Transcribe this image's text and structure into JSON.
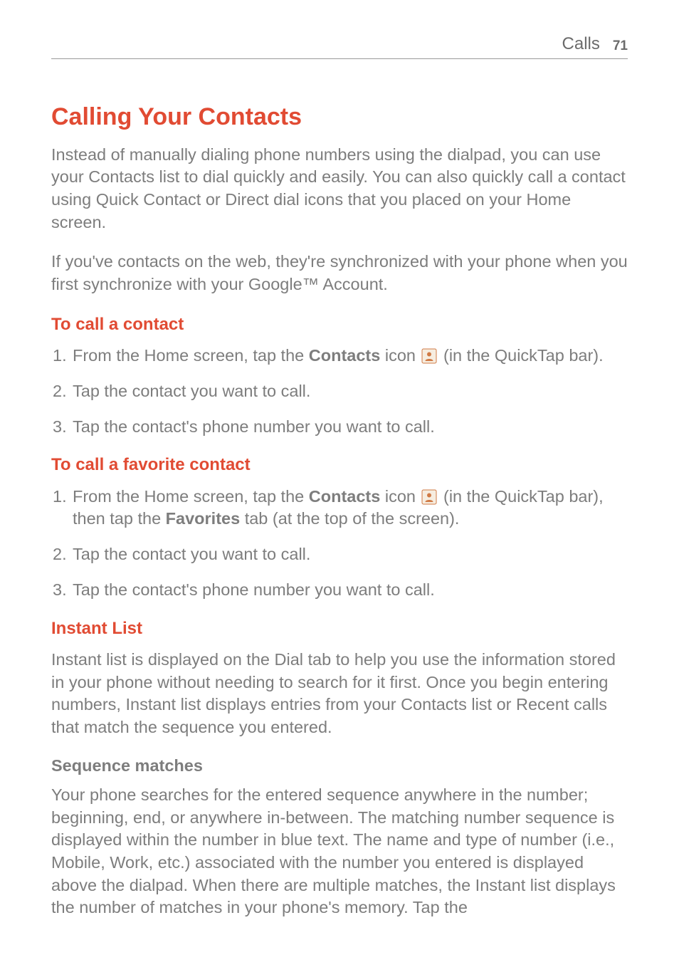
{
  "header": {
    "section": "Calls",
    "page_number": "71"
  },
  "h1": "Calling Your Contacts",
  "intro_p1": "Instead of manually dialing phone numbers using the dialpad, you can use your Contacts list to dial quickly and easily. You can also quickly call a contact using Quick Contact or Direct dial icons that you placed on your Home screen.",
  "intro_p2": "If you've contacts on the web, they're synchronized with your phone when you first synchronize with your Google™ Account.",
  "sub1": {
    "title": "To call a contact",
    "steps": {
      "s1_prefix": "From the Home screen, tap the ",
      "s1_bold": "Contacts",
      "s1_icon_label": " icon ",
      "s1_suffix": " (in the QuickTap bar).",
      "s2": "Tap the contact you want to call.",
      "s3": "Tap the contact's phone number you want to call."
    }
  },
  "sub2": {
    "title": "To call a favorite contact",
    "steps": {
      "s1_prefix": "From the Home screen, tap the ",
      "s1_bold": "Contacts",
      "s1_icon_label": " icon ",
      "s1_mid": " (in the QuickTap bar), then tap the ",
      "s1_bold2": "Favorites",
      "s1_suffix": " tab (at the top of the screen).",
      "s2": "Tap the contact you want to call.",
      "s3": "Tap the contact's phone number you want to call."
    }
  },
  "sub3": {
    "title": "Instant List",
    "body": "Instant list is displayed on the Dial tab to help you use the information stored in your phone without needing to search for it first. Once you begin entering numbers, Instant list displays entries from your Contacts list or Recent calls that match the sequence you entered."
  },
  "sub4": {
    "title": "Sequence matches",
    "body": "Your phone searches for the entered sequence anywhere in the number; beginning, end, or anywhere in-between. The matching number sequence is displayed within the number in blue text. The name and type of number (i.e., Mobile, Work, etc.) associated with the number you entered is displayed above the dialpad. When there are multiple matches, the Instant list displays the number of matches in your phone's memory. Tap the"
  },
  "icons": {
    "contacts": "contacts-icon"
  }
}
